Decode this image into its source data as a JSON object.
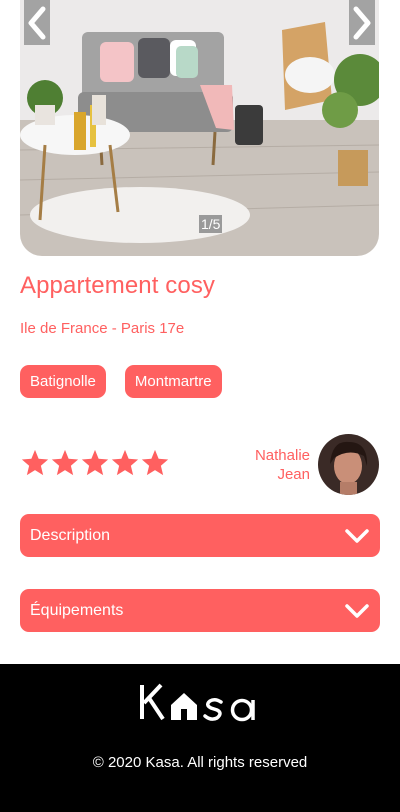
{
  "gallery": {
    "counter": "1/5",
    "prev_icon": "chevron-left-icon",
    "next_icon": "chevron-right-icon"
  },
  "listing": {
    "title": "Appartement cosy",
    "location": "Ile de France - Paris 17e",
    "tags": [
      "Batignolle",
      "Montmartre"
    ],
    "rating": 5,
    "rating_max": 5
  },
  "host": {
    "first_name": "Nathalie",
    "last_name": "Jean"
  },
  "collapsibles": {
    "description": "Description",
    "equipment": "Équipements"
  },
  "footer": {
    "copyright": "© 2020 Kasa. All rights reserved"
  },
  "colors": {
    "accent": "#ff6060",
    "footer_bg": "#000000"
  }
}
